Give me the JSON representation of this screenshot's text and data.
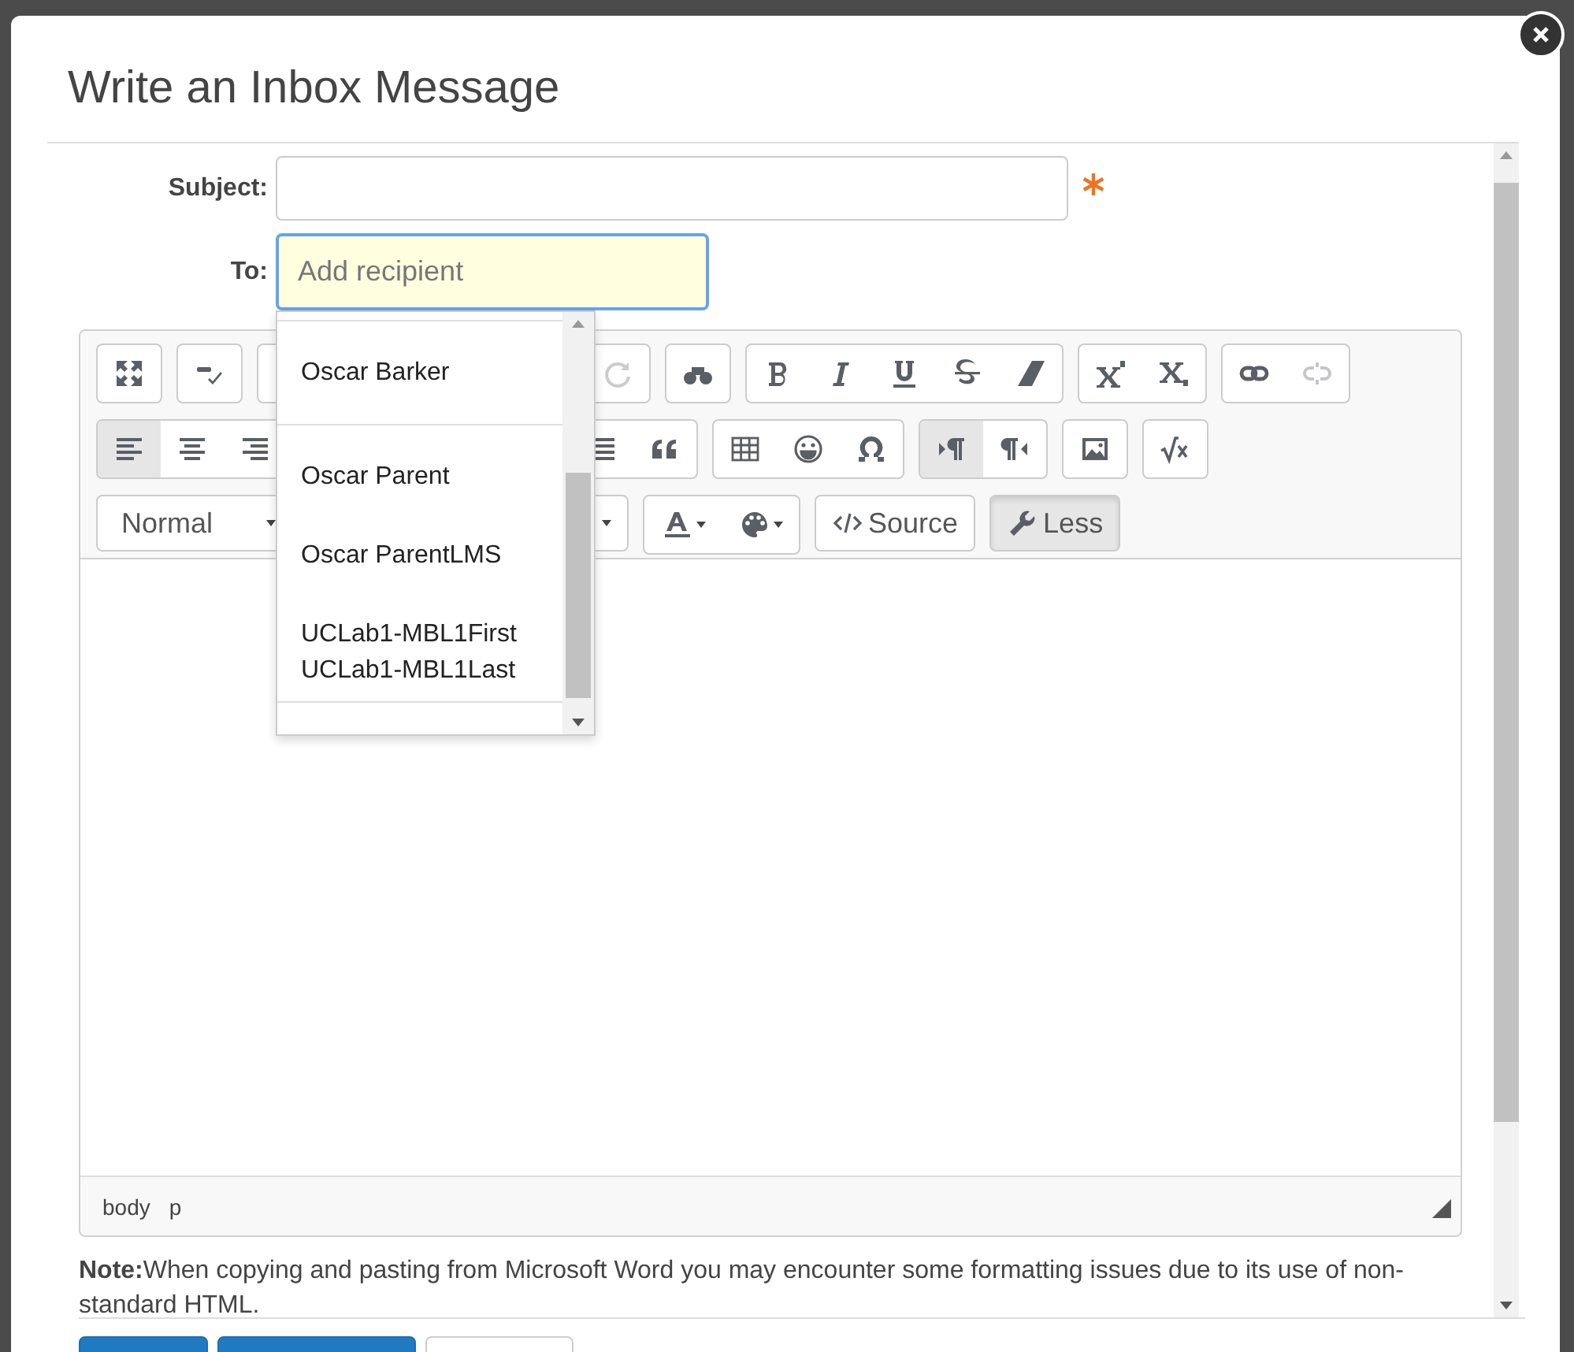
{
  "window": {
    "title": "Write an Inbox Message"
  },
  "form": {
    "subject": {
      "label": "Subject:",
      "required": true
    },
    "to": {
      "label": "To:",
      "placeholder": "Add recipient",
      "focused": true
    }
  },
  "recipient_suggestions": [
    {
      "name": "Oscar Barker"
    },
    {
      "name": "Oscar Parent"
    },
    {
      "name": "Oscar ParentLMS"
    },
    {
      "name": "UCLab1-MBL1First UCLab1-MBL1Last"
    }
  ],
  "editor": {
    "alignment_buttons": [
      {
        "kind": "left",
        "selected": true
      },
      {
        "kind": "center",
        "selected": false
      },
      {
        "kind": "right",
        "selected": false
      }
    ],
    "direction_buttons": [
      {
        "kind": "ltr",
        "selected": true
      },
      {
        "kind": "rtl",
        "selected": false
      }
    ],
    "link_buttons": [
      {
        "kind": "link",
        "disabled": false
      },
      {
        "kind": "unlink",
        "disabled": true
      }
    ],
    "format_select": {
      "value": "Normal"
    },
    "source_button": {
      "label": "Source"
    },
    "less_button": {
      "label": "Less",
      "pressed": true
    },
    "path": [
      "body",
      "p"
    ]
  },
  "note": "**Note:**When copying and pasting from Microsoft Word you may encounter some formatting issues due to its use of non-standard HTML."
}
